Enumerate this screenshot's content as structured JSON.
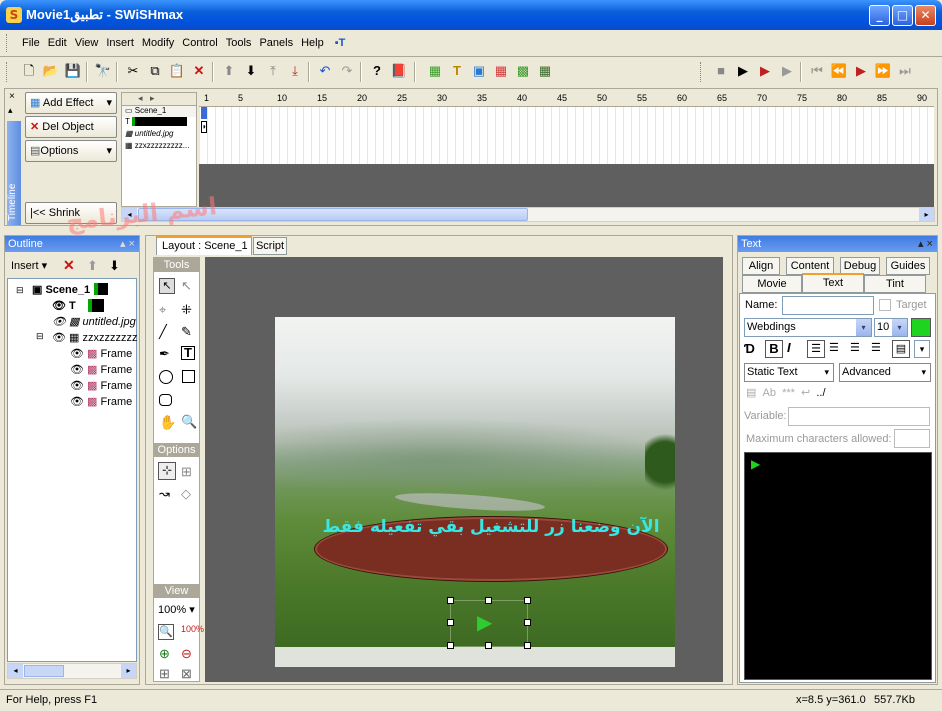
{
  "window": {
    "title": "Movie1تطبيق - SWiSHmax",
    "app_icon": "swishmax-icon"
  },
  "menu": [
    "File",
    "Edit",
    "View",
    "Insert",
    "Modify",
    "Control",
    "Tools",
    "Panels",
    "Help"
  ],
  "left_panel": {
    "add_effect": "Add Effect",
    "del_object": "Del Object",
    "options": "Options",
    "shrink": "Shrink",
    "vertical_label": "Timeline"
  },
  "timeline": {
    "scene_label": "Scene_1",
    "layers": [
      "",
      "untitled.jpg",
      "zzxzzzzzzzzz..."
    ],
    "ruler": [
      "1",
      "5",
      "10",
      "15",
      "20",
      "25",
      "30",
      "35",
      "40",
      "45",
      "50",
      "55",
      "60",
      "65",
      "70",
      "75",
      "80",
      "85",
      "90"
    ]
  },
  "watermark": "اسم البرنامج",
  "outline": {
    "title": "Outline",
    "insert": "Insert",
    "tree": [
      {
        "label": "Scene_1",
        "level": 0
      },
      {
        "label": "T",
        "level": 1
      },
      {
        "label": "untitled.jpg",
        "level": 1
      },
      {
        "label": "zzxzzzzzzz",
        "level": 1
      },
      {
        "label": "Frame",
        "level": 2
      },
      {
        "label": "Frame",
        "level": 2
      },
      {
        "label": "Frame",
        "level": 2
      },
      {
        "label": "Frame",
        "level": 2
      }
    ]
  },
  "layout_tabs": [
    "Layout : Scene_1",
    "Script"
  ],
  "tools": {
    "title": "Tools",
    "options": "Options",
    "view": "View",
    "zoom": "100%"
  },
  "stage": {
    "banner_text": "الآن وضعنا زر للتشغيل بقي تفعيله فقط"
  },
  "text_panel": {
    "title": "Text",
    "tabs_row1": [
      "Align",
      "Content",
      "Debug",
      "Guides"
    ],
    "tabs_row2": [
      "Movie",
      "Text",
      "Tint"
    ],
    "name_label": "Name:",
    "target_label": "Target",
    "font": "Webdings",
    "size": "10",
    "color": "#00ff00",
    "text_type": "Static Text",
    "advanced": "Advanced",
    "variable_label": "Variable:",
    "maxchars_label": "Maximum characters allowed:"
  },
  "status": {
    "help": "For Help, press F1",
    "coords": "x=8.5 y=361.0",
    "size": "557.7Kb"
  }
}
